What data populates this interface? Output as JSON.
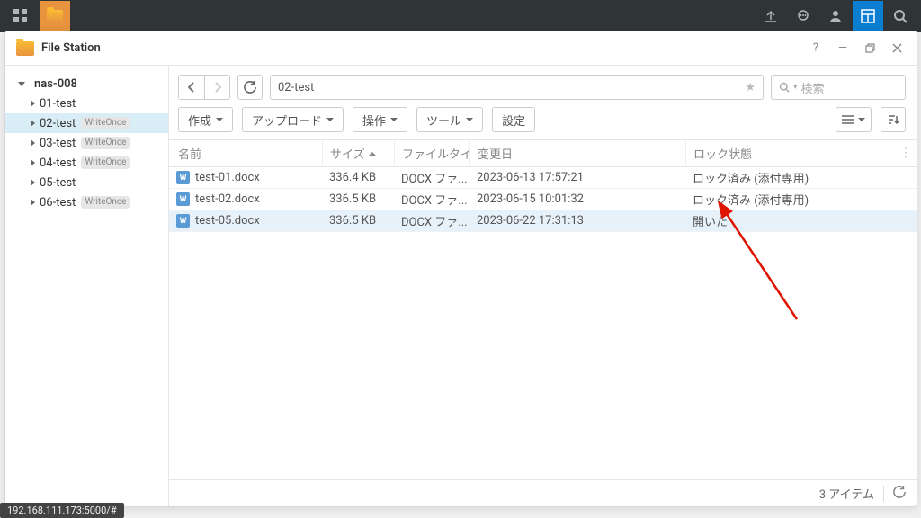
{
  "topbar": {
    "apps_icon": "apps",
    "folder_icon": "folder"
  },
  "window": {
    "title": "File Station"
  },
  "sidebar": {
    "root": "nas-008",
    "items": [
      {
        "label": "01-test",
        "badge": ""
      },
      {
        "label": "02-test",
        "badge": "WriteOnce",
        "selected": true
      },
      {
        "label": "03-test",
        "badge": "WriteOnce"
      },
      {
        "label": "04-test",
        "badge": "WriteOnce"
      },
      {
        "label": "05-test",
        "badge": ""
      },
      {
        "label": "06-test",
        "badge": "WriteOnce"
      }
    ]
  },
  "path": "02-test",
  "search_placeholder": "検索",
  "toolbar": {
    "create": "作成",
    "upload": "アップロード",
    "operate": "操作",
    "tools": "ツール",
    "settings": "設定"
  },
  "columns": {
    "name": "名前",
    "size": "サイズ",
    "type": "ファイルタイ...",
    "date": "変更日",
    "lock": "ロック状態"
  },
  "rows": [
    {
      "name": "test-01.docx",
      "size": "336.4 KB",
      "type": "DOCX ファ...",
      "date": "2023-06-13 17:57:21",
      "lock": "ロック済み (添付専用)"
    },
    {
      "name": "test-02.docx",
      "size": "336.5 KB",
      "type": "DOCX ファ...",
      "date": "2023-06-15 10:01:32",
      "lock": "ロック済み (添付専用)"
    },
    {
      "name": "test-05.docx",
      "size": "336.5 KB",
      "type": "DOCX ファ...",
      "date": "2023-06-22 17:31:13",
      "lock": "開いた",
      "selected": true
    }
  ],
  "status": {
    "count": "3 アイテム"
  },
  "url_hint": "192.168.111.173:5000/#"
}
